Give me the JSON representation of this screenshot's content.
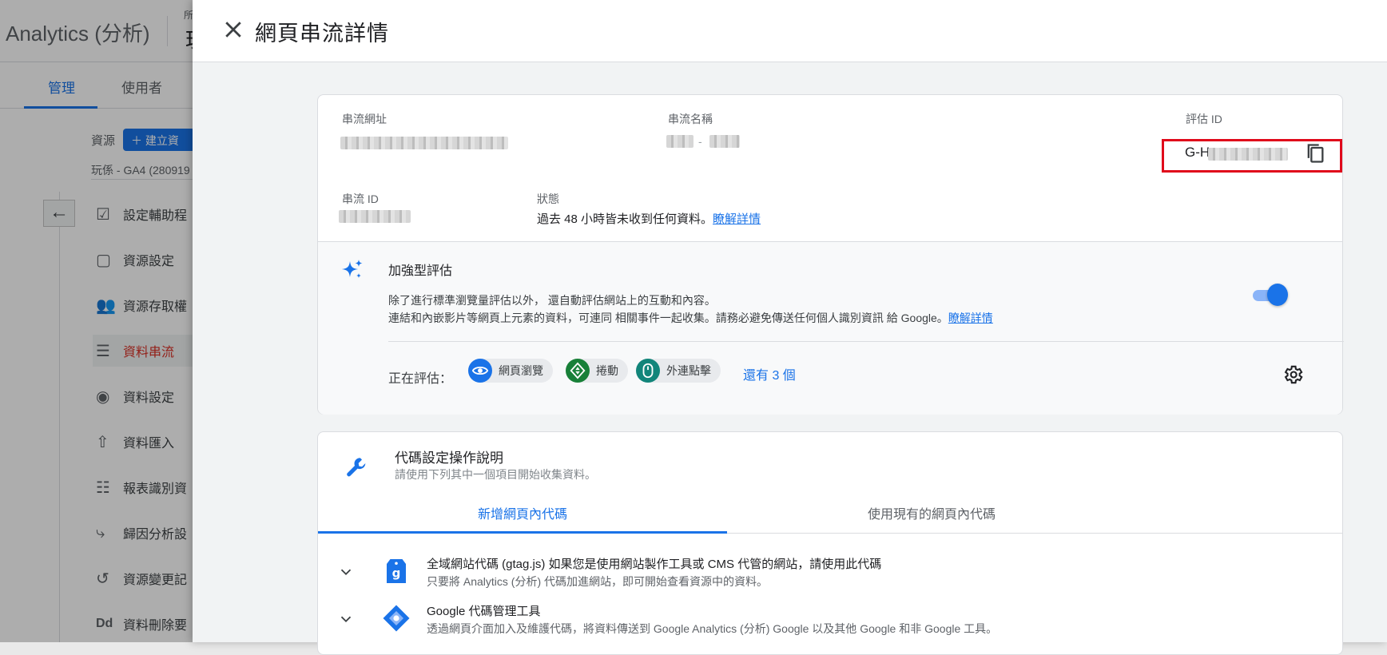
{
  "background": {
    "app_title": "Analytics (分析)",
    "crumb_small": "所",
    "crumb_big": "玩",
    "tabs": [
      {
        "label": "管理"
      },
      {
        "label": "使用者"
      }
    ],
    "resource_label": "資源",
    "create_button": "＋ 建立資",
    "property_name": "玩係 - GA4 (280919",
    "menu": [
      {
        "label": "設定輔助程"
      },
      {
        "label": "資源設定"
      },
      {
        "label": "資源存取權"
      },
      {
        "label": "資料串流"
      },
      {
        "label": "資料設定"
      },
      {
        "label": "資料匯入"
      },
      {
        "label": "報表識別資"
      },
      {
        "label": "歸因分析設"
      },
      {
        "label": "資源變更記"
      },
      {
        "label": "資料刪除要"
      }
    ]
  },
  "drawer": {
    "title": "網頁串流詳情",
    "details": {
      "stream_url_label": "串流網址",
      "stream_name_label": "串流名稱",
      "stream_name_sep": "-",
      "measurement_id_label": "評估 ID",
      "measurement_id_prefix": "G-H",
      "stream_id_label": "串流 ID",
      "status_label": "狀態",
      "status_text": "過去 48 小時皆未收到任何資料。",
      "status_link": "瞭解詳情"
    },
    "enhanced": {
      "title": "加強型評估",
      "desc_line1": "除了進行標準瀏覽量評估以外， 還自動評估網站上的互動和內容。",
      "desc_line2": "連結和內嵌影片等網頁上元素的資料，可連同 相關事件一起收集。請務必避免傳送任何個人識別資訊 給 Google。",
      "desc_link": "瞭解詳情",
      "enabled": true,
      "measuring_label": "正在評估：",
      "chips": [
        {
          "label": "網頁瀏覽",
          "icon": "eye-icon",
          "color": "#1a73e8"
        },
        {
          "label": "捲動",
          "icon": "scroll-icon",
          "color": "#188038"
        },
        {
          "label": "外連點擊",
          "icon": "mouse-icon",
          "color": "#12857a"
        }
      ],
      "more_link": "還有 3 個"
    },
    "tagging": {
      "title": "代碼設定操作說明",
      "subtitle": "請使用下列其中一個項目開始收集資料。",
      "tabs": [
        {
          "label": "新增網頁內代碼"
        },
        {
          "label": "使用現有的網頁內代碼"
        }
      ],
      "methods": [
        {
          "title": "全域網站代碼 (gtag.js) 如果您是使用網站製作工具或 CMS 代管的網站，請使用此代碼",
          "subtitle": "只要將 Analytics (分析) 代碼加進網站，即可開始查看資源中的資料。"
        },
        {
          "title": "Google 代碼管理工具",
          "subtitle": "透過網頁介面加入及維護代碼，將資料傳送到 Google Analytics (分析) Google 以及其他 Google 和非 Google 工具。"
        }
      ]
    }
  },
  "colors": {
    "accent": "#1a73e8",
    "highlight_box": "#e0091b",
    "active_menu_text": "#d93025"
  }
}
